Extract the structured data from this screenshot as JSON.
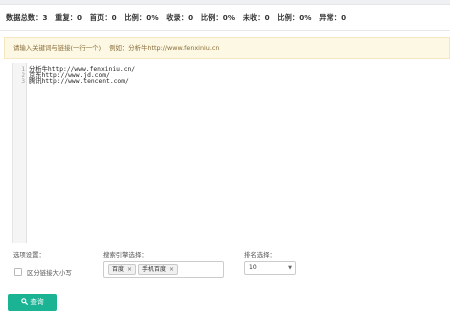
{
  "stats": [
    {
      "label": "数据总数：",
      "value": "3"
    },
    {
      "label": "重复：",
      "value": "0"
    },
    {
      "label": "首页：",
      "value": "0"
    },
    {
      "label": "比例：",
      "value": "0%"
    },
    {
      "label": "收录：",
      "value": "0"
    },
    {
      "label": "比例：",
      "value": "0%"
    },
    {
      "label": "未收：",
      "value": "0"
    },
    {
      "label": "比例：",
      "value": "0%"
    },
    {
      "label": "异常：",
      "value": "0"
    }
  ],
  "hint": {
    "text": "请输入关键词与链接(一行一个)",
    "example": "例如：分析牛http://www.fenxiniu.cn"
  },
  "editor": {
    "lines": [
      {
        "num": "1",
        "text": "分析牛http://www.fenxiniu.cn/"
      },
      {
        "num": "2",
        "text": "京东http://www.jd.com/"
      },
      {
        "num": "3",
        "text": "腾讯http://www.tencent.com/"
      }
    ]
  },
  "options": {
    "label": "选项设置：",
    "case_checkbox_label": "区分链接大小写",
    "case_checked": false
  },
  "engines": {
    "label": "搜索引擎选择：",
    "selected": [
      {
        "name": "百度",
        "remove": "×"
      },
      {
        "name": "手机百度",
        "remove": "×"
      }
    ]
  },
  "rank": {
    "label": "排名选择：",
    "value": "10",
    "arrow": "▼"
  },
  "query_button": {
    "label": "查询",
    "icon": "search-icon"
  },
  "colors": {
    "primary_button": "#1ab394",
    "hint_background": "#fcf8e3",
    "hint_text": "#8a6d3b"
  }
}
